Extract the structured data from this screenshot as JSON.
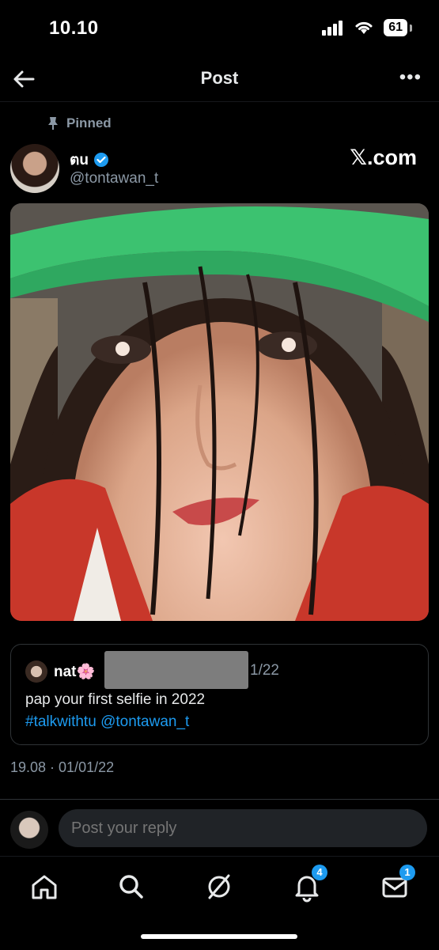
{
  "status": {
    "time": "10.10",
    "battery": "61"
  },
  "header": {
    "title": "Post"
  },
  "post": {
    "pinned_label": "Pinned",
    "author_name": "ตu",
    "author_handle": "@tontawan_t",
    "source_mark": "𝕏.com",
    "timestamp": "19.08 · 01/01/22"
  },
  "quote": {
    "author_name": "nat🌸",
    "date_fragment": "1/22",
    "text_line1": "pap your first selfie in 2022",
    "hashtag": "#talkwithtu",
    "mention": "@tontawan_t"
  },
  "reply": {
    "placeholder": "Post your reply"
  },
  "tabs": {
    "notifications_badge": "4",
    "messages_badge": "1"
  },
  "colors": {
    "accent": "#1d9bf0",
    "background": "#000000"
  }
}
